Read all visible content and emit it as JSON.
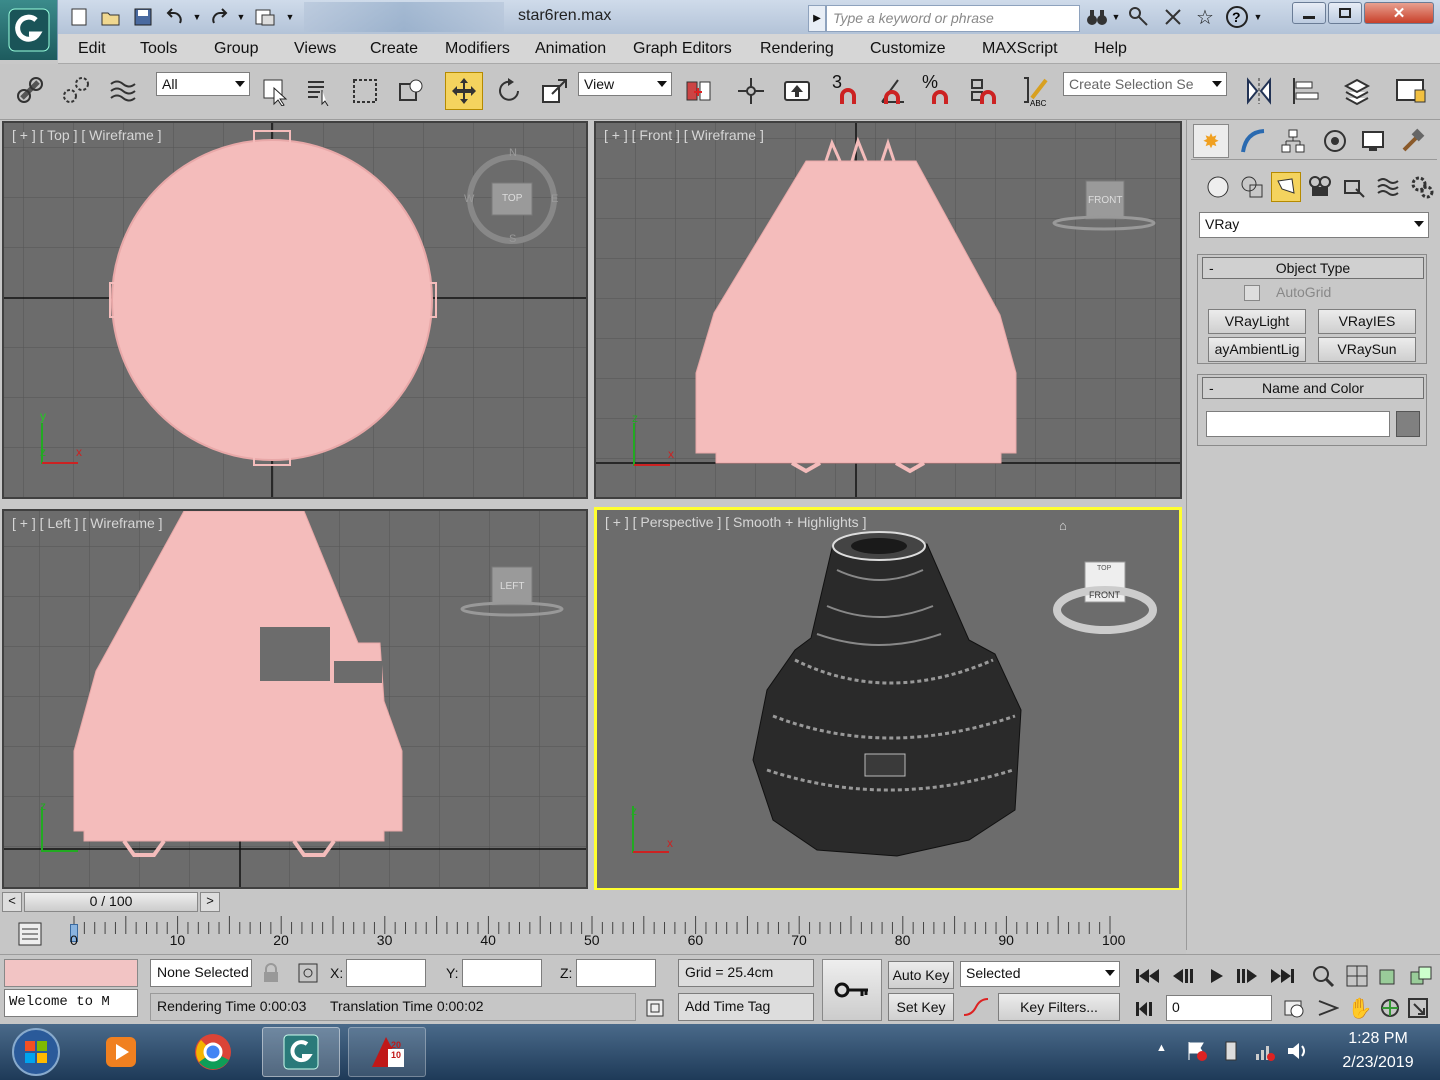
{
  "window": {
    "title": "star6ren.max",
    "search_placeholder": "Type a keyword or phrase"
  },
  "menu": [
    "Edit",
    "Tools",
    "Group",
    "Views",
    "Create",
    "Modifiers",
    "Animation",
    "Graph Editors",
    "Rendering",
    "Customize",
    "MAXScript",
    "Help"
  ],
  "toolbar": {
    "selection_filter": "All",
    "ref_coord": "View",
    "named_selection_placeholder": "Create Selection Se",
    "snap_number": "3"
  },
  "viewports": {
    "top": {
      "label": "[ + ] [ Top ] [ Wireframe ]",
      "cube": "TOP",
      "cube_letters": [
        "N",
        "W",
        "E",
        "S"
      ]
    },
    "front": {
      "label": "[ + ] [ Front ] [ Wireframe ]",
      "cube": "FRONT"
    },
    "left": {
      "label": "[ + ] [ Left ] [ Wireframe ]",
      "cube": "LEFT"
    },
    "persp": {
      "label": "[ + ] [ Perspective ] [ Smooth + Highlights ]",
      "cube": "FRONT",
      "cube_top": "TOP",
      "active_border": "#ffff30"
    },
    "axis": {
      "x": "x",
      "y": "y",
      "z": "z"
    }
  },
  "object_color": "#f4bcbb",
  "command_panel": {
    "category": "VRay",
    "object_type": {
      "title": "Object Type",
      "autogrid": "AutoGrid",
      "buttons": [
        "VRayLight",
        "VRayIES",
        "VRayAmbientLight",
        "VRaySun"
      ],
      "button_display": [
        "VRayLight",
        "VRayIES",
        "ayAmbientLig",
        "VRaySun"
      ]
    },
    "name_and_color": {
      "title": "Name and Color",
      "name_value": ""
    },
    "rollout_collapse": "-"
  },
  "timeline": {
    "frame": "0 / 100",
    "prev": "<",
    "next": ">",
    "ticks": [
      "10",
      "20",
      "30",
      "40",
      "50",
      "60",
      "70",
      "80",
      "90",
      "100"
    ],
    "start_tick": "0"
  },
  "status": {
    "maxscript_welcome": "Welcome to M",
    "selection": "None Selected",
    "x_label": "X:",
    "y_label": "Y:",
    "z_label": "Z:",
    "x_value": "",
    "y_value": "",
    "z_value": "",
    "grid": "Grid = 25.4cm",
    "rendering_time": "Rendering Time  0:00:03",
    "translation_time": "Translation Time  0:00:02",
    "add_time_tag": "Add Time Tag",
    "auto_key": "Auto Key",
    "set_key": "Set Key",
    "key_mode": "Selected",
    "key_filters": "Key Filters...",
    "current_frame": "0"
  },
  "taskbar": {
    "time": "1:28 PM",
    "date": "2/23/2019",
    "autocad_badge": "20 10"
  }
}
